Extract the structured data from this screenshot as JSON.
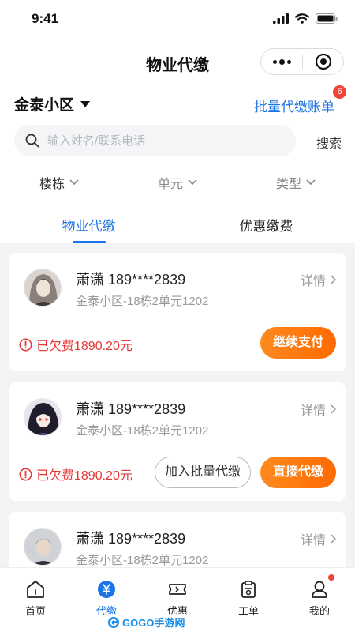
{
  "status_bar": {
    "time": "9:41"
  },
  "nav": {
    "title": "物业代缴"
  },
  "community": {
    "name": "金泰小区",
    "batch_link": "批量代缴账单",
    "batch_count": "6"
  },
  "search": {
    "placeholder": "输入姓名/联系电话",
    "button": "搜索"
  },
  "filters": [
    {
      "label": "楼栋"
    },
    {
      "label": "单元"
    },
    {
      "label": "类型"
    }
  ],
  "tabs": [
    {
      "label": "物业代缴",
      "active": true
    },
    {
      "label": "优惠缴费",
      "active": false
    }
  ],
  "cards": [
    {
      "name": "萧潇 189****2839",
      "address": "金泰小区-18栋2单元1202",
      "detail": "详情",
      "owe": "已欠费1890.20元",
      "primary_button": "继续支付"
    },
    {
      "name": "萧潇 189****2839",
      "address": "金泰小区-18栋2单元1202",
      "detail": "详情",
      "owe": "已欠费1890.20元",
      "secondary_button": "加入批量代缴",
      "primary_button": "直接代缴"
    },
    {
      "name": "萧潇 189****2839",
      "address": "金泰小区-18栋2单元1202",
      "detail": "详情"
    }
  ],
  "tabbar": [
    {
      "label": "首页",
      "icon": "home-icon"
    },
    {
      "label": "代缴",
      "icon": "yuan-icon",
      "active": true
    },
    {
      "label": "优惠",
      "icon": "ticket-icon"
    },
    {
      "label": "工单",
      "icon": "clipboard-icon"
    },
    {
      "label": "我的",
      "icon": "user-icon",
      "dot": true
    }
  ],
  "watermark": {
    "text": "GOGO手游网"
  },
  "colors": {
    "primary": "#1a73e8",
    "accent_orange": "#ff7a00",
    "alert_red": "#e53935",
    "badge_red": "#f04438"
  }
}
